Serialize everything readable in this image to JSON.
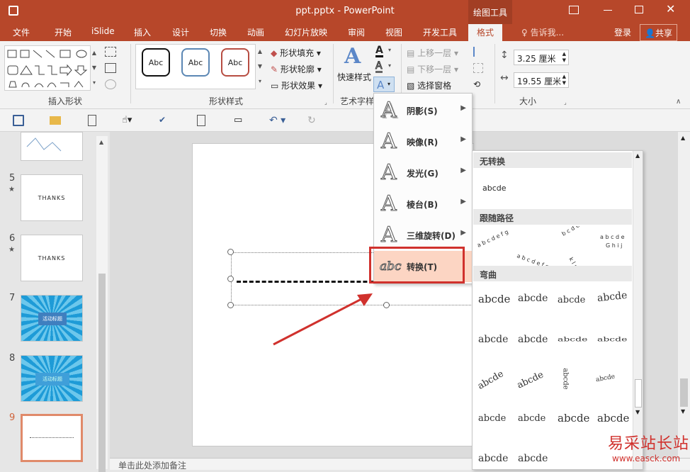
{
  "window": {
    "title": "ppt.pptx - PowerPoint",
    "context_tab": "绘图工具"
  },
  "tabs": [
    "文件",
    "开始",
    "iSlide",
    "插入",
    "设计",
    "切换",
    "动画",
    "幻灯片放映",
    "审阅",
    "视图",
    "开发工具",
    "格式"
  ],
  "tell_me": "告诉我...",
  "login": "登录",
  "share": "共享",
  "ribbon": {
    "insert_shapes_label": "插入形状",
    "shape_styles_label": "形状样式",
    "style_sample_text": "Abc",
    "shape_fill": "形状填充",
    "shape_outline": "形状轮廓",
    "shape_effects": "形状效果",
    "quick_styles": "快速样式",
    "wordart_label": "艺术字样",
    "bring_forward": "上移一层",
    "send_backward": "下移一层",
    "selection_pane": "选择窗格",
    "height_value": "3.25 厘米",
    "width_value": "19.55 厘米",
    "size_label": "大小"
  },
  "thumbnails": [
    {
      "num": "5",
      "text": "THANKS"
    },
    {
      "num": "6",
      "text": "THANKS"
    },
    {
      "num": "7",
      "text": "活动标题"
    },
    {
      "num": "8",
      "text": "活动标题"
    },
    {
      "num": "9",
      "text": ""
    }
  ],
  "notes_placeholder": "单击此处添加备注",
  "text_effects_menu": [
    {
      "label": "阴影(S)"
    },
    {
      "label": "映像(R)"
    },
    {
      "label": "发光(G)"
    },
    {
      "label": "棱台(B)"
    },
    {
      "label": "三维旋转(D)"
    },
    {
      "label": "转换(T)"
    }
  ],
  "transform_submenu": {
    "no_transform": "无转换",
    "no_transform_sample": "abcde",
    "follow_path": "跟随路径",
    "warp": "弯曲",
    "sample": "abcde"
  },
  "watermark": {
    "text": "易采站长站",
    "url": "www.easck.com"
  },
  "colors": {
    "accent": "#b7472a",
    "highlight": "#fcd5c3",
    "callout": "#d0312d"
  }
}
